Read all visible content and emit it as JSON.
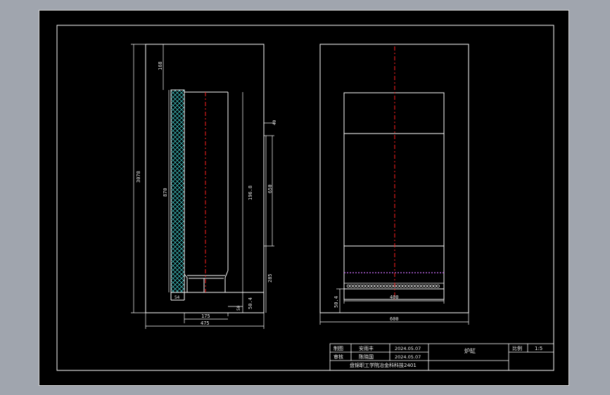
{
  "drawing": {
    "left_view": {
      "dim_total_height": "3078",
      "dim_top_gap": "168",
      "dim_lining_height": "870",
      "dim_inner_height": "196.8",
      "dim_right_segment": "650",
      "dim_small_top": "40",
      "dim_bottom_segment": "285",
      "dim_base_height": "50.4",
      "dim_side_small": "50",
      "dim_base_left": "54",
      "dim_bottom_width_1": "175",
      "dim_bottom_width_2": "475"
    },
    "right_view": {
      "dim_bottom_width": "400",
      "dim_total_width": "600",
      "dim_left_small": "50.4"
    }
  },
  "title_block": {
    "row1_label": "制图",
    "row1_name": "安雨丰",
    "row1_date": "2024.05.07",
    "row2_label": "审核",
    "row2_name": "陈晓国",
    "row2_date": "2024.05.07",
    "part_name": "炉缸",
    "scale_label": "比例",
    "scale_value": "1:5",
    "org": "盘锦职工学院冶金科科技2401"
  },
  "colors": {
    "background": "#a0a5ae",
    "paper": "#000000",
    "line": "#ffffff",
    "center_line": "#ff2020",
    "hatch": "#40c0c0",
    "dots": "#d070ff"
  }
}
